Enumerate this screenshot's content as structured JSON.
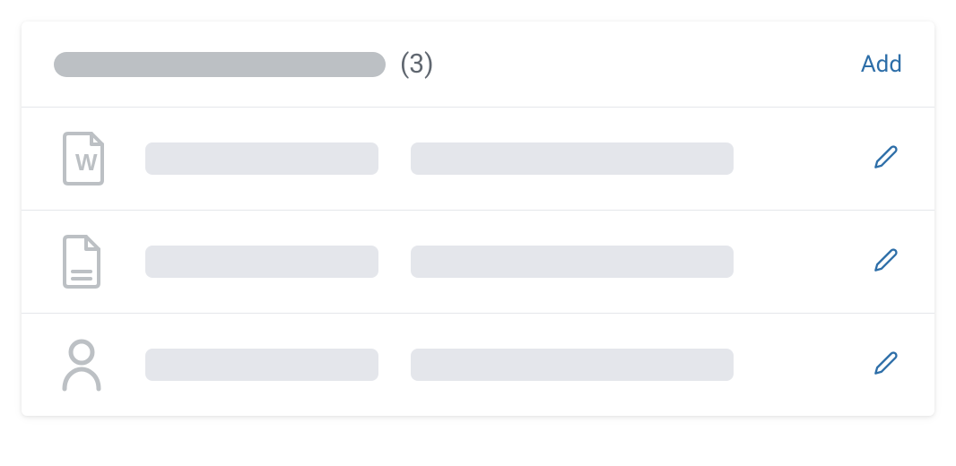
{
  "header": {
    "count_label": "(3)",
    "add_label": "Add"
  },
  "rows": [
    {
      "icon": "word-document-icon"
    },
    {
      "icon": "document-icon"
    },
    {
      "icon": "person-icon"
    }
  ]
}
